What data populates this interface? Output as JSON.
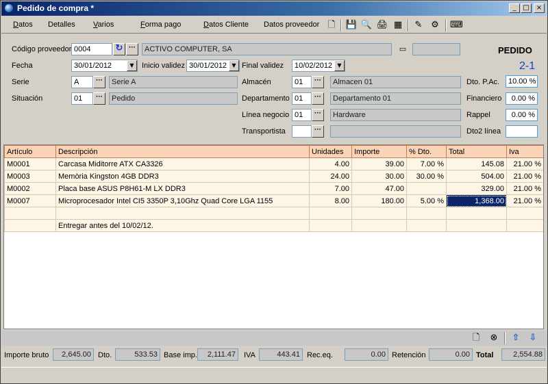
{
  "window": {
    "title": "Pedido de compra *"
  },
  "menu": [
    {
      "label": "Datos",
      "accel": "D",
      "rest": "atos"
    },
    {
      "label": "Detalles",
      "accel": "",
      "rest": "Detalles"
    },
    {
      "label": "Varios",
      "accel": "V",
      "rest": "arios"
    },
    {
      "label": "Forma pago",
      "accel": "F",
      "rest": "orma pago"
    },
    {
      "label": "Datos Cliente",
      "accel": "D",
      "rest": "atos Cliente"
    },
    {
      "label": "Datos proveedor",
      "accel": "",
      "rest": "Datos proveedor"
    }
  ],
  "header": {
    "proveedor_label": "Código proveedor",
    "proveedor_code": "0004",
    "proveedor_name": "ACTIVO COMPUTER, SA",
    "doc_type": "PEDIDO",
    "doc_number": "2-1",
    "fecha_label": "Fecha",
    "fecha": "30/01/2012",
    "inicio_label": "Inicio validez",
    "inicio": "30/01/2012",
    "final_label": "Final validez",
    "final": "10/02/2012",
    "serie_label": "Serie",
    "serie_code": "A",
    "serie_name": "Serie A",
    "situacion_label": "Situación",
    "situacion_code": "01",
    "situacion_name": "Pedido",
    "almacen_label": "Almacén",
    "almacen_code": "01",
    "almacen_name": "Almacen 01",
    "departamento_label": "Departamento",
    "departamento_code": "01",
    "departamento_name": "Departamento 01",
    "linea_label": "Línea negocio",
    "linea_code": "01",
    "linea_name": "Hardware",
    "transportista_label": "Transportista",
    "transportista_code": "",
    "transportista_name": "",
    "dto_pac_label": "Dto. P.Ac.",
    "dto_pac": "10.00 %",
    "financiero_label": "Financiero",
    "financiero": "0.00 %",
    "rappel_label": "Rappel",
    "rappel": "0.00 %",
    "dto2_label": "Dto2 línea",
    "dto2": ""
  },
  "table": {
    "columns": [
      "Artículo",
      "Descripción",
      "Unidades",
      "Importe",
      "% Dto.",
      "Total",
      "Iva"
    ],
    "rows": [
      [
        "M0001",
        "Carcasa Miditorre ATX CA3326",
        "4.00",
        "39.00",
        "7.00 %",
        "145.08",
        "21.00 %"
      ],
      [
        "M0003",
        "Memòria Kingston 4GB DDR3",
        "24.00",
        "30.00",
        "30.00 %",
        "504.00",
        "21.00 %"
      ],
      [
        "M0002",
        "Placa base ASUS P8H61-M LX DDR3",
        "7.00",
        "47.00",
        "",
        "329.00",
        "21.00 %"
      ],
      [
        "M0007",
        "Microprocesador Intel CI5 3350P 3,10Ghz Quad Core LGA 1155",
        "8.00",
        "180.00",
        "5.00 %",
        "1,368.00",
        "21.00 %"
      ],
      [
        "",
        "",
        "",
        "",
        "",
        "",
        ""
      ],
      [
        "",
        "Entregar antes del 10/02/12.",
        "",
        "",
        "",
        "",
        ""
      ]
    ]
  },
  "footer": {
    "bruto_label": "Importe bruto",
    "bruto": "2,645.00",
    "dto_label": "Dto.",
    "dto": "533.53",
    "base_label": "Base imp.",
    "base": "2,111.47",
    "iva_label": "IVA",
    "iva": "443.41",
    "receq_label": "Rec.eq.",
    "receq": "0.00",
    "retencion_label": "Retención",
    "retencion": "0.00",
    "total_label": "Total",
    "total": "2,554.88"
  }
}
